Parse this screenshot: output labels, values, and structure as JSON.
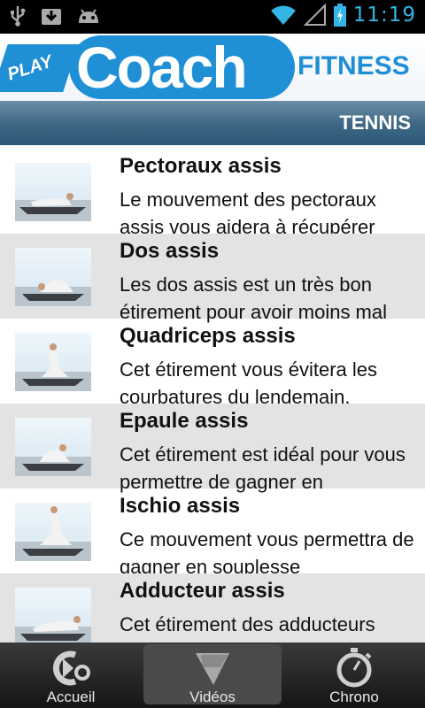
{
  "status_bar": {
    "time": "11:19",
    "left_icons": [
      "usb-icon",
      "download-icon",
      "android-icon"
    ],
    "right_icons": [
      "wifi-icon",
      "signal-icon",
      "battery-charging-icon"
    ],
    "accent": "#33b5e5"
  },
  "banner": {
    "play": "PLAY",
    "coach": "Coach",
    "fitness": "FITNESS",
    "brand_color": "#1f8fd6"
  },
  "section": {
    "title": "TENNIS"
  },
  "exercises": [
    {
      "title": "Pectoraux assis",
      "description": "Le mouvement des pectoraux assis vous aidera à récupérer"
    },
    {
      "title": "Dos assis",
      "description": "Les dos assis est un très bon étirement pour avoir moins mal"
    },
    {
      "title": "Quadriceps assis",
      "description": "Cet étirement vous évitera les courbatures du lendemain."
    },
    {
      "title": "Epaule assis",
      "description": "Cet étirement est idéal pour vous permettre de gagner en"
    },
    {
      "title": "Ischio assis",
      "description": "Ce mouvement vous permettra de gagner en souplesse"
    },
    {
      "title": "Adducteur assis",
      "description": "Cet étirement des adducteurs"
    }
  ],
  "nav": {
    "items": [
      {
        "label": "Accueil",
        "icon": "home-logo-icon"
      },
      {
        "label": "Vidéos",
        "icon": "play-icon",
        "active": true
      },
      {
        "label": "Chrono",
        "icon": "stopwatch-icon"
      }
    ]
  }
}
